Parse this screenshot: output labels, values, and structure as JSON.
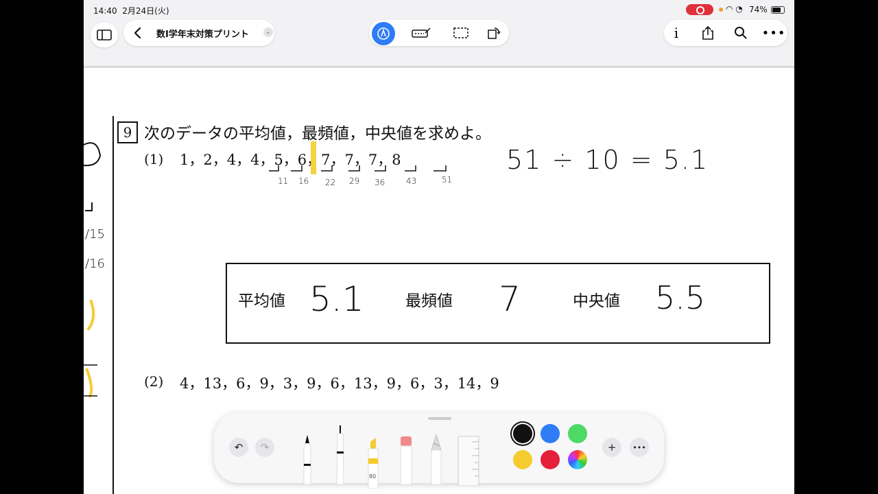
{
  "status": {
    "time": "14:40",
    "date": "2月24日(火)",
    "battery": "74%"
  },
  "toolbar": {
    "doc_title": "数Ⅰ学年末対策プリント"
  },
  "problem": {
    "number": "9",
    "instruction": "次のデータの平均値，最頻値，中央値を求めよ。",
    "part1_label": "(1)",
    "part1_data": "1，2，4，4，5，6，7，7，7，8",
    "part2_label": "(2)",
    "part2_data": "4，13，6，9，3，9，6，13，9，6，3，14，9"
  },
  "annotations": {
    "cumulative_sums": [
      "11",
      "16",
      "22",
      "29",
      "36",
      "43",
      "51"
    ],
    "calculation": "51 ÷ 10 = 5.1",
    "margin_notes": [
      "15",
      "16"
    ]
  },
  "answer_box": {
    "mean_label": "平均値",
    "mean_value": "5.1",
    "mode_label": "最頻値",
    "mode_value": "7",
    "median_label": "中央値",
    "median_value": "5.5"
  },
  "palette": {
    "highlighter_opacity": "80",
    "colors": [
      "#111111",
      "#2e7cf6",
      "#4cd964",
      "#f5cc2e",
      "#e5203a",
      "rainbow"
    ]
  }
}
